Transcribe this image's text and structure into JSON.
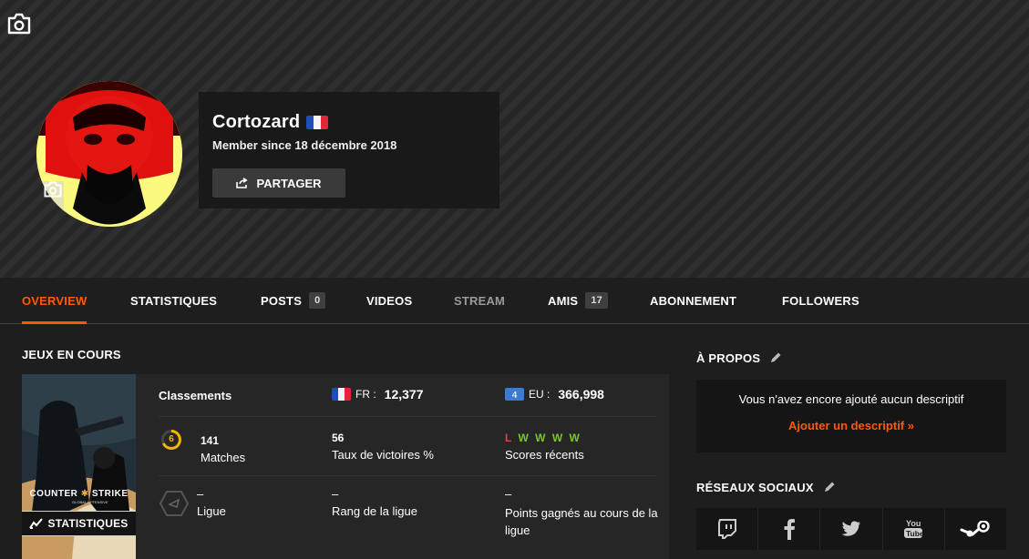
{
  "profile": {
    "username": "Cortozard",
    "member_since": "Member since 18 décembre 2018",
    "share_label": "PARTAGER"
  },
  "tabs": [
    {
      "label": "OVERVIEW",
      "active": true
    },
    {
      "label": "STATISTIQUES"
    },
    {
      "label": "POSTS",
      "count": "0"
    },
    {
      "label": "VIDEOS"
    },
    {
      "label": "STREAM"
    },
    {
      "label": "AMIS",
      "count": "17"
    },
    {
      "label": "ABONNEMENT"
    },
    {
      "label": "FOLLOWERS"
    }
  ],
  "games": {
    "title": "JEUX EN COURS",
    "cover_logo_line1": "COUNTER",
    "cover_logo_line2": "STRIKE",
    "cover_logo_sub": "GLOBAL OFFENSIVE",
    "stats_button": "STATISTIQUES",
    "rankings_label": "Classements",
    "fr_code": "FR :",
    "fr_rank": "12,377",
    "eu_code": "EU :",
    "eu_rank": "366,998",
    "level": "6",
    "matches_value": "141",
    "matches_label": "Matches",
    "winrate_value": "56",
    "winrate_label": "Taux de victoires %",
    "recent_results": [
      "L",
      "W",
      "W",
      "W",
      "W"
    ],
    "recent_label": "Scores récents",
    "league_value": "–",
    "league_label": "Ligue",
    "league_rank_value": "–",
    "league_rank_label": "Rang de la ligue",
    "league_points_value": "–",
    "league_points_label": "Points gagnés au cours de la ligue"
  },
  "about": {
    "title": "À PROPOS",
    "empty_text": "Vous n'avez encore ajouté aucun descriptif",
    "add_link": "Ajouter un descriptif »"
  },
  "social": {
    "title": "RÉSEAUX SOCIAUX",
    "networks": [
      "twitch-icon",
      "facebook-icon",
      "twitter-icon",
      "youtube-icon",
      "steam-icon"
    ]
  },
  "colors": {
    "accent": "#ff5a00",
    "win": "#7cc42c",
    "loss": "#e0453f",
    "level_ring": "#f5b400"
  }
}
